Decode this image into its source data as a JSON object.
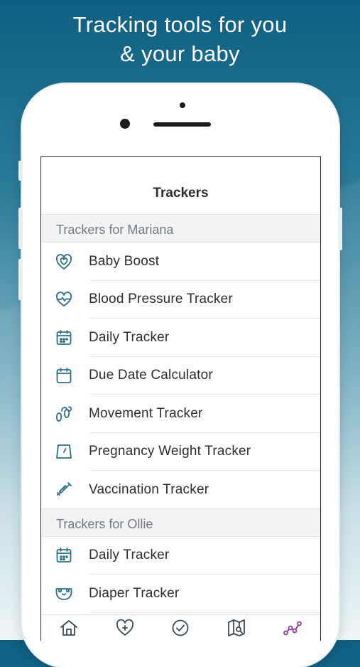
{
  "headline": {
    "line1": "Tracking tools for you",
    "line2": "& your baby"
  },
  "screen": {
    "title": "Trackers",
    "sections": [
      {
        "header": "Trackers for Mariana",
        "items": [
          {
            "label": "Baby Boost",
            "icon": "heart-circle-icon"
          },
          {
            "label": "Blood Pressure Tracker",
            "icon": "heart-pulse-icon"
          },
          {
            "label": "Daily Tracker",
            "icon": "calendar-icon"
          },
          {
            "label": "Due Date Calculator",
            "icon": "calendar-blank-icon"
          },
          {
            "label": "Movement Tracker",
            "icon": "baby-feet-icon"
          },
          {
            "label": "Pregnancy Weight Tracker",
            "icon": "scale-icon"
          },
          {
            "label": "Vaccination Tracker",
            "icon": "syringe-icon"
          }
        ]
      },
      {
        "header": "Trackers for Ollie",
        "items": [
          {
            "label": "Daily Tracker",
            "icon": "calendar-icon"
          },
          {
            "label": "Diaper Tracker",
            "icon": "diaper-icon"
          }
        ]
      }
    ],
    "tabs": [
      {
        "name": "home-icon"
      },
      {
        "name": "heart-plus-icon"
      },
      {
        "name": "check-circle-icon"
      },
      {
        "name": "map-search-icon"
      },
      {
        "name": "trackers-graph-icon",
        "active": true
      }
    ]
  },
  "colors": {
    "icon": "#2f6f86",
    "active_tab": "#8b3d96",
    "inactive_tab": "#3d4b56"
  }
}
